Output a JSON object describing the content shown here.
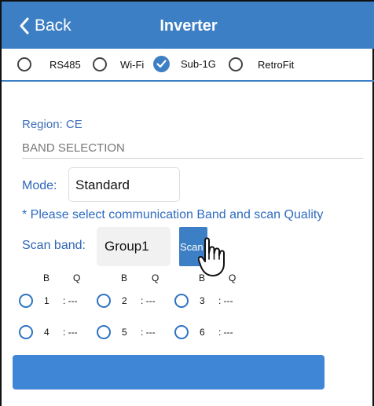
{
  "header": {
    "back_label": "Back",
    "title": "Inverter"
  },
  "connection_options": [
    {
      "label": "RS485",
      "selected": false
    },
    {
      "label": "Wi-Fi",
      "selected": false
    },
    {
      "label": "Sub-1G",
      "selected": true
    },
    {
      "label": "RetroFit",
      "selected": false
    }
  ],
  "region": {
    "text": "Region:  CE"
  },
  "band_selection": {
    "heading": "BAND SELECTION"
  },
  "mode": {
    "label": "Mode:",
    "value": "Standard"
  },
  "note": "* Please select communication Band and scan Quality",
  "scan": {
    "label": "Scan band:",
    "value": "Group1",
    "button_label": "Scan"
  },
  "channel_headers": [
    {
      "b": "B",
      "q": "Q"
    },
    {
      "b": "B",
      "q": "Q"
    },
    {
      "b": "B",
      "q": "Q"
    }
  ],
  "channels": [
    {
      "band": "1",
      "quality": ": ---"
    },
    {
      "band": "2",
      "quality": ": ---"
    },
    {
      "band": "3",
      "quality": ": ---"
    },
    {
      "band": "4",
      "quality": ": ---"
    },
    {
      "band": "5",
      "quality": ": ---"
    },
    {
      "band": "6",
      "quality": ": ---"
    }
  ],
  "colors": {
    "accent": "#3d7fc4",
    "label_blue": "#2e66b5",
    "bottom_button": "#3f86d6"
  }
}
